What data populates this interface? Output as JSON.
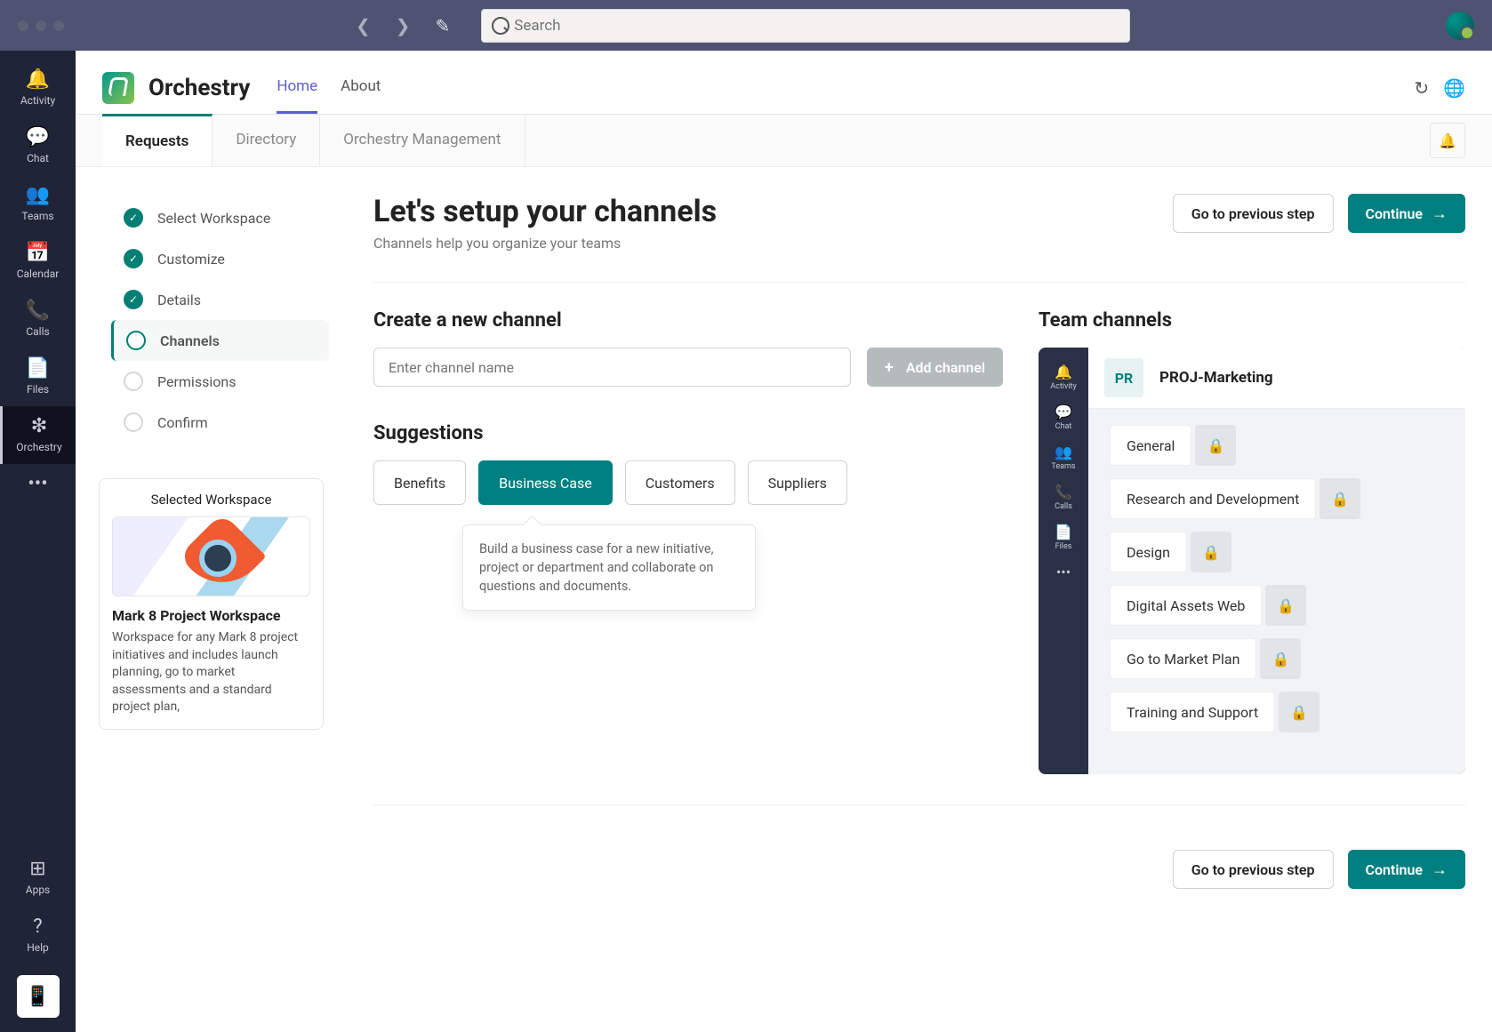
{
  "search": {
    "placeholder": "Search"
  },
  "rail": [
    {
      "icon": "🔔",
      "label": "Activity"
    },
    {
      "icon": "💬",
      "label": "Chat"
    },
    {
      "icon": "👥",
      "label": "Teams"
    },
    {
      "icon": "📅",
      "label": "Calendar"
    },
    {
      "icon": "📞",
      "label": "Calls"
    },
    {
      "icon": "📄",
      "label": "Files"
    },
    {
      "icon": "❇",
      "label": "Orchestry"
    }
  ],
  "rail_bottom": {
    "apps": "Apps",
    "help": "Help"
  },
  "app": {
    "name": "Orchestry",
    "tabs": [
      {
        "label": "Home",
        "active": true
      },
      {
        "label": "About",
        "active": false
      }
    ]
  },
  "subtabs": [
    {
      "label": "Requests",
      "active": true
    },
    {
      "label": "Directory",
      "active": false
    },
    {
      "label": "Orchestry Management",
      "active": false
    }
  ],
  "steps": [
    {
      "label": "Select Workspace",
      "state": "done"
    },
    {
      "label": "Customize",
      "state": "done"
    },
    {
      "label": "Details",
      "state": "done"
    },
    {
      "label": "Channels",
      "state": "current"
    },
    {
      "label": "Permissions",
      "state": "pending"
    },
    {
      "label": "Confirm",
      "state": "pending"
    }
  ],
  "selected_workspace": {
    "heading": "Selected Workspace",
    "name": "Mark 8 Project Workspace",
    "description": "Workspace for any Mark 8 project initiatives and includes launch planning, go to market assessments and a standard project plan,"
  },
  "page": {
    "title": "Let's setup your channels",
    "subtitle": "Channels help you organize your teams",
    "prev": "Go to previous step",
    "continue": "Continue"
  },
  "create": {
    "heading": "Create a new channel",
    "placeholder": "Enter channel name",
    "add_label": "Add channel"
  },
  "suggestions": {
    "heading": "Suggestions",
    "items": [
      {
        "label": "Benefits",
        "active": false
      },
      {
        "label": "Business Case",
        "active": true
      },
      {
        "label": "Customers",
        "active": false
      },
      {
        "label": "Suppliers",
        "active": false
      }
    ],
    "tooltip": "Build a business case for a new initiative, project or department and collaborate on questions and documents."
  },
  "team_panel": {
    "heading": "Team channels",
    "badge": "PR",
    "title": "PROJ-Marketing",
    "mini_rail": [
      {
        "icon": "🔔",
        "label": "Activity"
      },
      {
        "icon": "💬",
        "label": "Chat"
      },
      {
        "icon": "👥",
        "label": "Teams"
      },
      {
        "icon": "📞",
        "label": "Calls"
      },
      {
        "icon": "📄",
        "label": "Files"
      }
    ],
    "channels": [
      {
        "label": "General"
      },
      {
        "label": "Research and Development"
      },
      {
        "label": "Design"
      },
      {
        "label": "Digital Assets Web"
      },
      {
        "label": "Go to Market Plan"
      },
      {
        "label": "Training and Support"
      }
    ]
  }
}
